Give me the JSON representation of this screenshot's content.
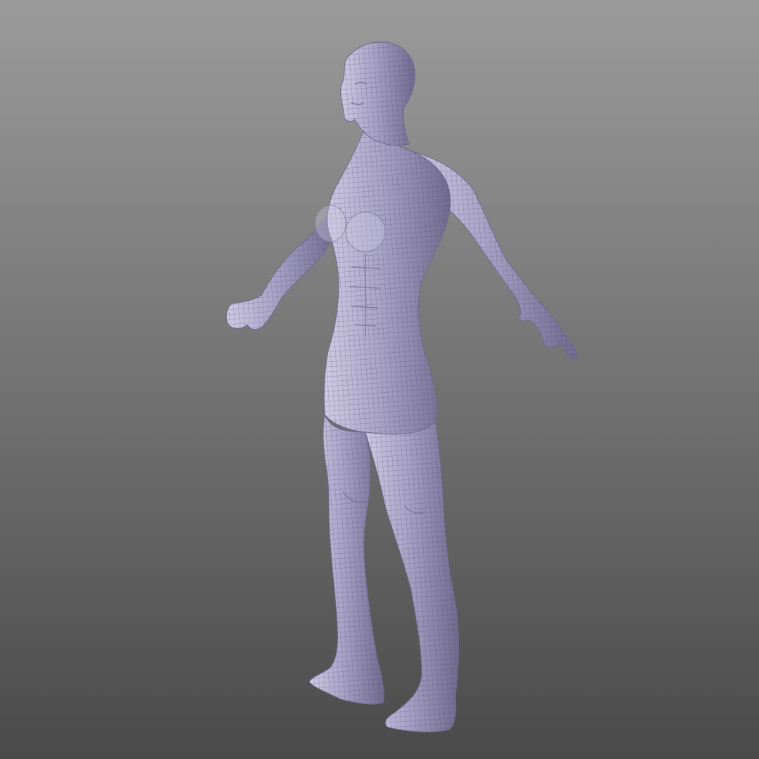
{
  "viewport": {
    "background_top": "#9b9b9b",
    "background_bottom": "#4a4a4a"
  },
  "model": {
    "subject": "human-body-mesh",
    "pose": "a-pose",
    "display_mode": "wireframe-on-shaded",
    "surface_color": "#a8a3c6",
    "surface_shadow": "#6f6a8e",
    "surface_highlight": "#cfcbe4",
    "wire_color": "#4d4868"
  }
}
